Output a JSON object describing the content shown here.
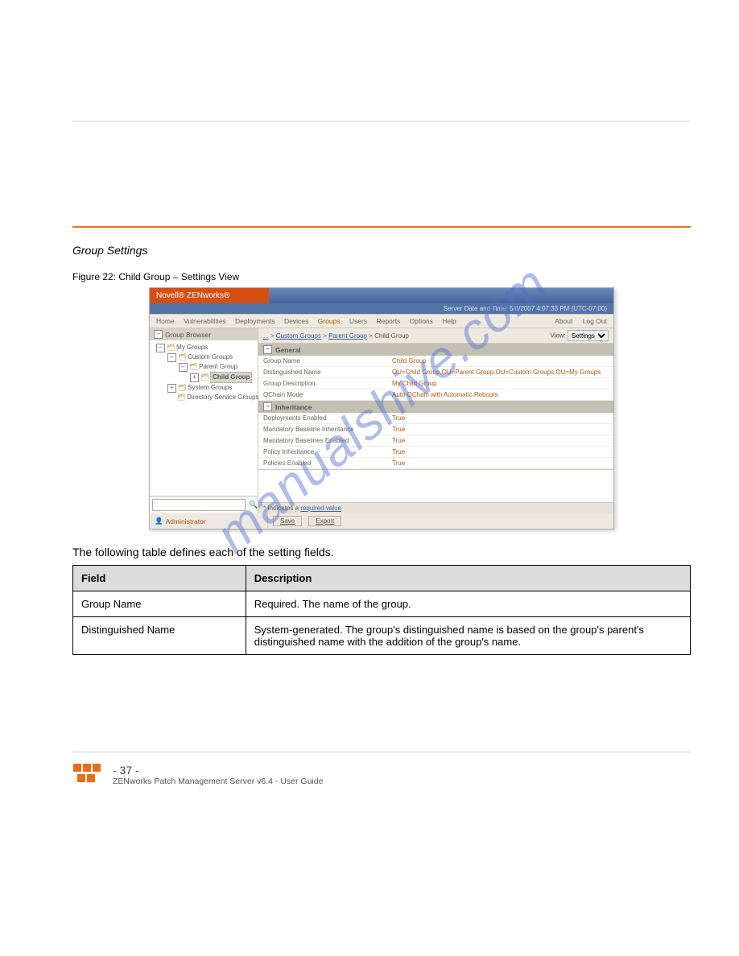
{
  "header_spacer": "",
  "intro": "Group Settings",
  "figure_label": "Figure 22: Child Group – Settings View",
  "screenshot": {
    "brand": "Novell® ZENworks®",
    "server_time": "Server Date and Time: 5/8/2007 4:07:33 PM (UTC-07:00)",
    "menu": {
      "items": [
        "Home",
        "Vulnerabilities",
        "Deployments",
        "Devices",
        "Groups",
        "Users",
        "Reports",
        "Options",
        "Help"
      ],
      "active": "Groups",
      "right": [
        "About",
        "Log Out"
      ]
    },
    "left": {
      "title": "Group Browser",
      "tree": {
        "root": "My Groups",
        "custom": "Custom Groups",
        "parent": "Parent Group",
        "child": "Child Group",
        "system": "System Groups",
        "directory": "Directory Service Groups"
      }
    },
    "breadcrumb": {
      "up": "...",
      "seg1": "Custom Groups",
      "seg2": "Parent Group",
      "seg3": "Child Group",
      "view_label": "View:",
      "view_value": "Settings"
    },
    "sections": {
      "general": "General",
      "inheritance": "Inheritance"
    },
    "general_rows": [
      {
        "k": "Group Name",
        "v": "Child Group"
      },
      {
        "k": "Distinguished Name",
        "v": "OU=Child Group,OU=Parent Group,OU=Custom Groups,OU=My Groups"
      },
      {
        "k": "Group Description",
        "v": "My Child Group"
      },
      {
        "k": "QChain Mode",
        "v": "Auto QChain with Automatic Reboots"
      }
    ],
    "inh_rows": [
      {
        "k": "Deployments Enabled",
        "v": "True"
      },
      {
        "k": "Mandatory Baseline Inheritance",
        "v": "True"
      },
      {
        "k": "Mandatory Baselines Enabled",
        "v": "True"
      },
      {
        "k": "Policy Inheritance",
        "v": "True"
      },
      {
        "k": "Policies Enabled",
        "v": "True"
      }
    ],
    "required_note_star": "*",
    "required_note_a": "Indicates a ",
    "required_note_b": "required value",
    "footer": {
      "admin": "Administrator",
      "save": "Save",
      "export": "Export"
    }
  },
  "watermark": "manualshive.com",
  "para": "The following table defines each of the setting fields.",
  "table": {
    "col1": "Field",
    "col2": "Description",
    "r1c1": "Group Name",
    "r1c2": "Required. The name of the group.",
    "r2c1": "Distinguished Name",
    "r2c2": "System-generated. The group's distinguished name is based on the group's parent's distinguished name with the addition of the group's name."
  },
  "foot": {
    "line1": "- 37 -",
    "line2": "ZENworks Patch Management Server v6.4 - User Guide"
  }
}
